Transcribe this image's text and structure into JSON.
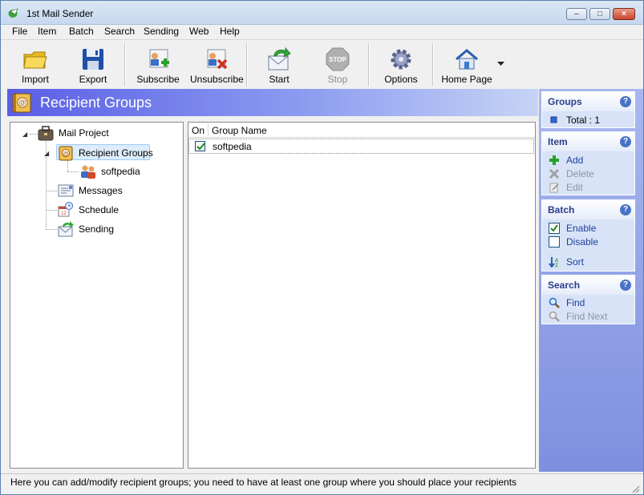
{
  "window": {
    "title": "1st Mail Sender",
    "min": "–",
    "max": "□",
    "close": "×"
  },
  "menu": [
    "File",
    "Item",
    "Batch",
    "Search",
    "Sending",
    "Web",
    "Help"
  ],
  "toolbar": {
    "import": "Import",
    "export": "Export",
    "subscribe": "Subscribe",
    "unsubscribe": "Unsubscribe",
    "start": "Start",
    "stop": "Stop",
    "options": "Options",
    "home_page": "Home Page"
  },
  "header": {
    "title": "Recipient Groups"
  },
  "tree": {
    "root": "Mail Project",
    "recipient_groups": "Recipient Groups",
    "group": "softpedia",
    "messages": "Messages",
    "schedule": "Schedule",
    "sending": "Sending"
  },
  "grid": {
    "columns": [
      "On",
      "Group Name"
    ],
    "rows": [
      {
        "on": true,
        "name": "softpedia"
      }
    ]
  },
  "side": {
    "groups": {
      "title": "Groups",
      "total": "Total : 1"
    },
    "item": {
      "title": "Item",
      "add": "Add",
      "delete": "Delete",
      "edit": "Edit"
    },
    "batch": {
      "title": "Batch",
      "enable": "Enable",
      "disable": "Disable",
      "sort": "Sort"
    },
    "search": {
      "title": "Search",
      "find": "Find",
      "find_next": "Find Next"
    },
    "help_glyph": "?"
  },
  "status": {
    "text": "Here you can add/modify recipient groups; you need to have at least one group where you should place your recipients"
  },
  "colors": {
    "accent": "#5a5ee6",
    "panel": "#d8e3f7",
    "link": "#1f3f9c"
  }
}
